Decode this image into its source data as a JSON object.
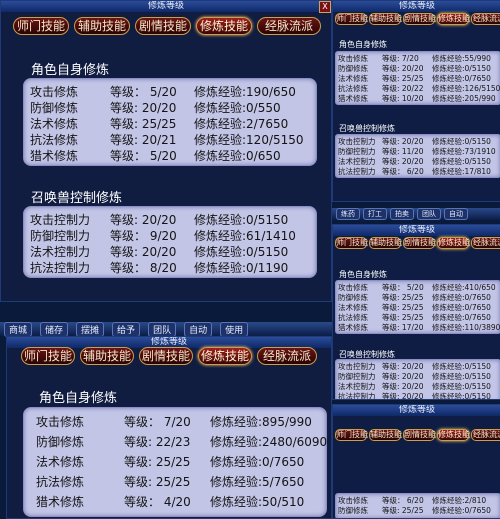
{
  "window_title": "修炼等级",
  "tabs": [
    "师门技能",
    "辅助技能",
    "剧情技能",
    "修炼技能",
    "经脉流派"
  ],
  "active_tab": "修炼技能",
  "colors": {
    "accent": "#caa04a",
    "panel_bg": "#c2c5e6",
    "tab_bg": "#6b1414",
    "window_bg": "#0f1d44"
  },
  "p1": {
    "char_title": "角色自身修炼",
    "char_rows": [
      {
        "name": "攻击修炼",
        "level": "等级： 5/20",
        "exp": "修炼经验:190/650"
      },
      {
        "name": "防御修炼",
        "level": "等级: 20/20",
        "exp": "修炼经验:0/550"
      },
      {
        "name": "法术修炼",
        "level": "等级: 25/25",
        "exp": "修炼经验:2/7650"
      },
      {
        "name": "抗法修炼",
        "level": "等级: 20/21",
        "exp": "修炼经验:120/5150"
      },
      {
        "name": "猎术修炼",
        "level": "等级： 5/20",
        "exp": "修炼经验:0/650"
      }
    ],
    "pet_title": "召唤兽控制修炼",
    "pet_rows": [
      {
        "name": "攻击控制力",
        "level": "等级: 20/20",
        "exp": "修炼经验:0/5150"
      },
      {
        "name": "防御控制力",
        "level": "等级： 9/20",
        "exp": "修炼经验:61/1410"
      },
      {
        "name": "法术控制力",
        "level": "等级: 20/20",
        "exp": "修炼经验:0/5150"
      },
      {
        "name": "抗法控制力",
        "level": "等级： 8/20",
        "exp": "修炼经验:0/1190"
      }
    ]
  },
  "p2": {
    "char_title": "角色自身修炼",
    "char_rows": [
      {
        "name": "攻击修炼",
        "level": "等级： 7/20",
        "exp": "修炼经验:895/990"
      },
      {
        "name": "防御修炼",
        "level": "等级: 22/23",
        "exp": "修炼经验:2480/6090"
      },
      {
        "name": "法术修炼",
        "level": "等级: 25/25",
        "exp": "修炼经验:0/7650"
      },
      {
        "name": "抗法修炼",
        "level": "等级: 25/25",
        "exp": "修炼经验:5/7650"
      },
      {
        "name": "猎术修炼",
        "level": "等级： 4/20",
        "exp": "修炼经验:50/510"
      }
    ]
  },
  "s1": {
    "char_title": "角色自身修炼",
    "char_rows": [
      {
        "name": "攻击修炼",
        "level": "等级: 7/20",
        "exp": "修炼经验:55/990"
      },
      {
        "name": "防御修炼",
        "level": "等级: 20/20",
        "exp": "修炼经验:0/5150"
      },
      {
        "name": "法术修炼",
        "level": "等级: 25/25",
        "exp": "修炼经验:0/7650"
      },
      {
        "name": "抗法修炼",
        "level": "等级: 20/22",
        "exp": "修炼经验:126/5150"
      },
      {
        "name": "猎术修炼",
        "level": "等级: 10/20",
        "exp": "修炼经验:205/990"
      }
    ],
    "pet_title": "召唤兽控制修炼",
    "pet_rows": [
      {
        "name": "攻击控制力",
        "level": "等级: 20/20",
        "exp": "修炼经验:0/5150"
      },
      {
        "name": "防御控制力",
        "level": "等级: 11/20",
        "exp": "修炼经验:73/1910"
      },
      {
        "name": "法术控制力",
        "level": "等级: 20/20",
        "exp": "修炼经验:0/5150"
      },
      {
        "name": "抗法控制力",
        "level": "等级： 6/20",
        "exp": "修炼经验:17/810"
      }
    ]
  },
  "s2": {
    "char_title": "角色自身修炼",
    "char_rows": [
      {
        "name": "攻击修炼",
        "level": "等级： 5/20",
        "exp": "修炼经验:410/650"
      },
      {
        "name": "防御修炼",
        "level": "等级: 25/25",
        "exp": "修炼经验:0/7650"
      },
      {
        "name": "法术修炼",
        "level": "等级: 25/25",
        "exp": "修炼经验:0/7650"
      },
      {
        "name": "抗法修炼",
        "level": "等级: 25/25",
        "exp": "修炼经验:0/7650"
      },
      {
        "name": "猎术修炼",
        "level": "等级: 17/20",
        "exp": "修炼经验:110/3890"
      }
    ],
    "pet_title": "召唤兽控制修炼",
    "pet_rows": [
      {
        "name": "攻击控制力",
        "level": "等级: 20/20",
        "exp": "修炼经验:0/5150"
      },
      {
        "name": "防御控制力",
        "level": "等级: 20/20",
        "exp": "修炼经验:0/5150"
      },
      {
        "name": "法术控制力",
        "level": "等级: 20/20",
        "exp": "修炼经验:0/5150"
      },
      {
        "name": "抗法控制力",
        "level": "等级: 20/20",
        "exp": "修炼经验:0/5150"
      }
    ]
  },
  "s3": {
    "char_rows": [
      {
        "name": "攻击修炼",
        "level": "等级： 6/20",
        "exp": "修炼经验:2/810"
      },
      {
        "name": "防御修炼",
        "level": "等级: 25/25",
        "exp": "修炼经验:0/7650"
      }
    ]
  },
  "bottom_bar": [
    "商城",
    "储存",
    "摆摊",
    "给予",
    "团队",
    "自动",
    "使用"
  ],
  "mini_bar": [
    "练药",
    "打工",
    "拍卖",
    "团队",
    "自动"
  ],
  "close_glyph": "X"
}
